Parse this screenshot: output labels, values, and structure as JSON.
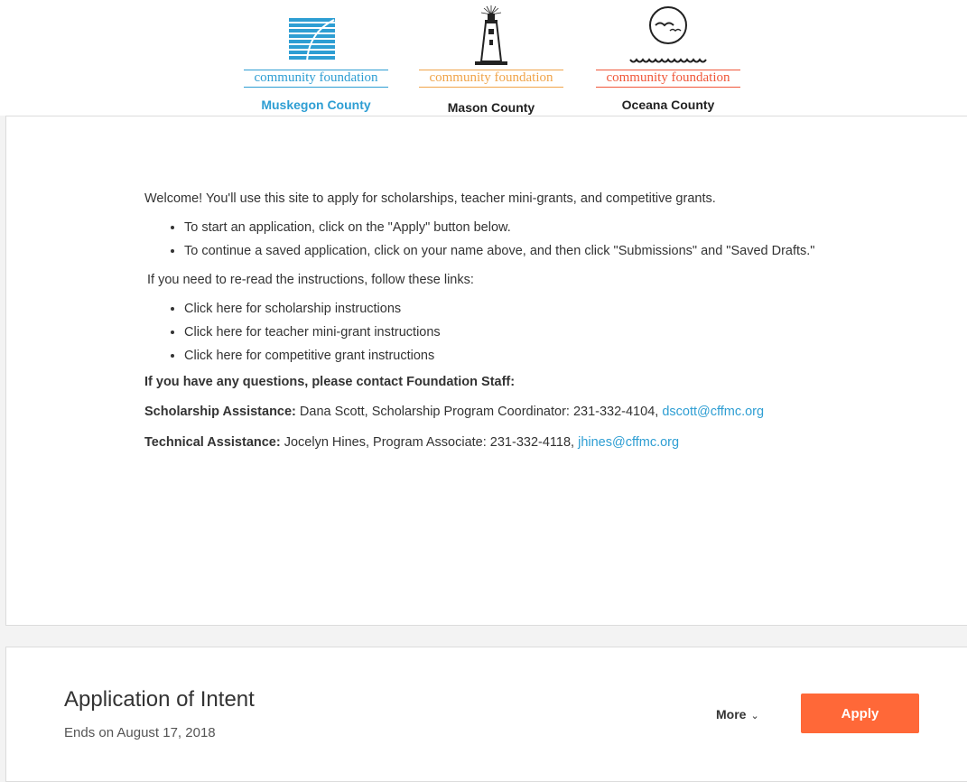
{
  "header": {
    "logos": [
      {
        "foundation": "community foundation",
        "county": "Muskegon County",
        "color": "#2e9ed3",
        "icon": "waves-flag-icon"
      },
      {
        "foundation": "community foundation",
        "county": "Mason County",
        "color": "#f0a44a",
        "icon": "lighthouse-icon"
      },
      {
        "foundation": "community foundation",
        "county": "Oceana County",
        "color": "#f0573a",
        "icon": "seagulls-waves-icon"
      }
    ]
  },
  "welcome": {
    "intro": "Welcome!  You'll use this site to apply for scholarships, teacher mini-grants, and competitive grants.",
    "steps": [
      "To start an application, click on the \"Apply\" button below.",
      "To continue a saved application, click on your name above, and then click \"Submissions\" and \"Saved Drafts.\""
    ],
    "links_intro": "If you need to re-read the instructions, follow these links:",
    "links": [
      "Click here for scholarship instructions",
      "Click here for teacher mini-grant instructions",
      "Click here for competitive grant instructions"
    ],
    "questions_heading": "If you have any questions, please contact Foundation Staff:",
    "scholarship": {
      "label": "Scholarship Assistance:",
      "text": " Dana Scott, Scholarship Program Coordinator: 231-332-4104, ",
      "email": "dscott@cffmc.org"
    },
    "technical": {
      "label": "Technical Assistance:",
      "text": " Jocelyn Hines, Program Associate: 231-332-4118, ",
      "email": "jhines@cffmc.org"
    }
  },
  "opportunity": {
    "title": "Application of Intent",
    "ends": "Ends on August 17, 2018",
    "more_label": "More",
    "apply_label": "Apply",
    "accent": "#ff6838"
  }
}
